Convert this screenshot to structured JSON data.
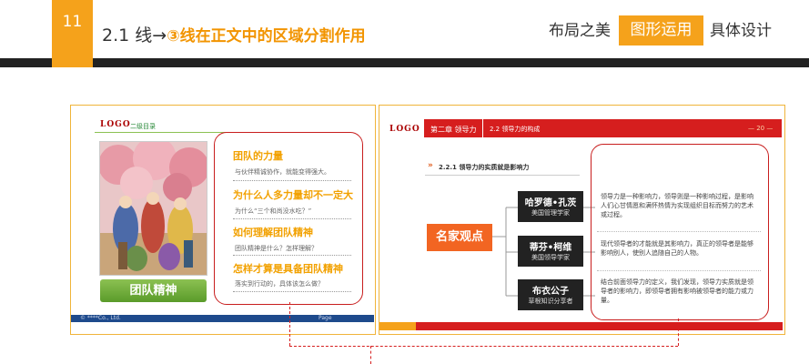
{
  "header": {
    "section_number": "11",
    "title_prefix": "2.1 线→",
    "title_highlight": "③线在正文中的区域分割作用",
    "nav_items": [
      "布局之美",
      "图形运用",
      "具体设计"
    ],
    "active_nav": "图形运用",
    "accent_color": "#f5a21b"
  },
  "left_slide": {
    "logo": "LOGO",
    "subtitle": "二级目录",
    "items": [
      {
        "title": "团队的力量",
        "sub": "与伙伴精诚协作，就能变得强大。"
      },
      {
        "title": "为什么人多力量却不一定大",
        "sub": "为什么“三个和尚没水吃？”"
      },
      {
        "title": "如何理解团队精神",
        "sub": "团队精神是什么？怎样理解？"
      },
      {
        "title": "怎样才算是具备团队精神",
        "sub": "落实到行动的，具体该怎么做？"
      }
    ],
    "button_label": "团队精神",
    "footer_left": "© ****Co., Ltd.",
    "footer_right": "Page"
  },
  "right_slide": {
    "logo": "LOGO",
    "chapter": "第二章 领导力",
    "section": "2.2 领导力的构成",
    "page_tag": "— 20 —",
    "heading": "2.2.1 领导力的实质就是影响力",
    "center_label": "名家观点",
    "people": [
      {
        "name": "哈罗德•孔茨",
        "role": "美国管理学家",
        "quote": "领导力是一种影响力，领导则是一种影响过程，是影响人们心甘情愿和满怀热情为实现组织目标而努力的艺术或过程。"
      },
      {
        "name": "蒂芬•柯维",
        "role": "美国领导学家",
        "quote": "现代领导者的才能就是其影响力，真正的领导者是能够影响别人，使别人追随自己的人物。"
      },
      {
        "name": "布衣公子",
        "role": "草根知识分享者",
        "quote": "结合前面领导力的定义，我们发现，领导力实质就是领导者的影响力，即领导者拥有影响被领导者的能力或力量。"
      }
    ]
  }
}
